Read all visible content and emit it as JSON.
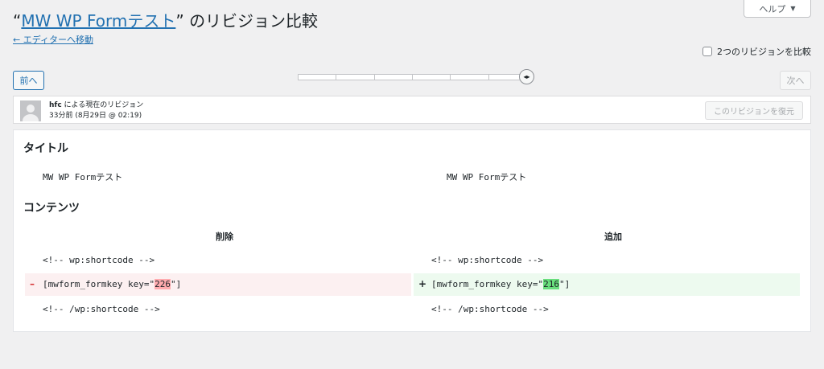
{
  "header": {
    "title_prefix": "“",
    "title_link": "MW WP Formテスト",
    "title_suffix": "” のリビジョン比較",
    "back_link": "← エディターへ移動",
    "help_label": "ヘルプ",
    "help_caret": "▼",
    "compare_label": "2つのリビジョンを比較"
  },
  "nav": {
    "prev_label": "前へ",
    "next_label": "次へ",
    "handle_glyph": "◂▸"
  },
  "revision": {
    "author": "hfc",
    "by_text": " による現在のリビジョン",
    "time": "33分前 (8月29日 @ 02:19)",
    "restore_label": "このリビジョンを復元"
  },
  "diff": {
    "title_heading": "タイトル",
    "title_left": "MW WP Formテスト",
    "title_right": "MW WP Formテスト",
    "content_heading": "コンテンツ",
    "col_deleted": "削除",
    "col_added": "追加",
    "line1_left": "<!-- wp:shortcode -->",
    "line1_right": "<!-- wp:shortcode -->",
    "del_sign": "–",
    "add_sign": "+",
    "line2_left_pre": "[mwform_formkey key=\"",
    "line2_left_mark": "226",
    "line2_left_post": "\"]",
    "line2_right_pre": "[mwform_formkey key=\"",
    "line2_right_mark": "216",
    "line2_right_post": "\"]",
    "line3_left": "<!-- /wp:shortcode -->",
    "line3_right": "<!-- /wp:shortcode -->"
  },
  "colors": {
    "link": "#2271b1",
    "deleted_bg": "#fcf0f1",
    "deleted_mark": "#ffabaf",
    "added_bg": "#edfaef",
    "added_mark": "#68de7c"
  }
}
